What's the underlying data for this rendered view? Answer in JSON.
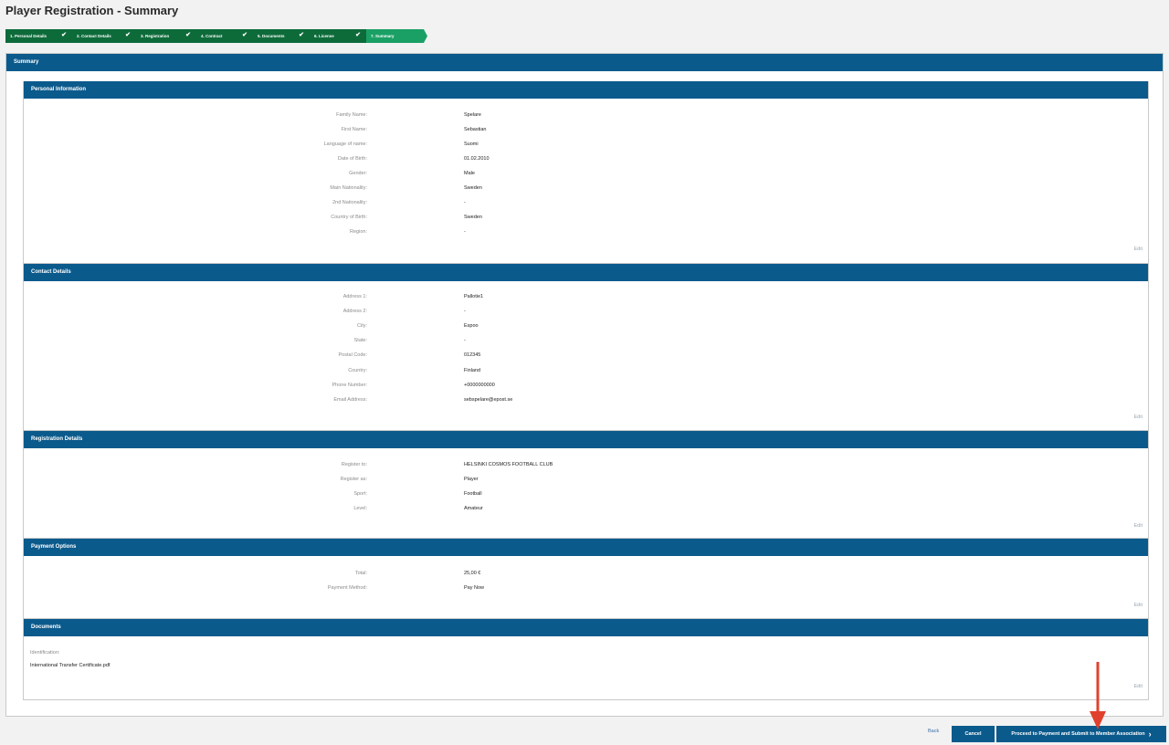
{
  "page_title": "Player Registration - Summary",
  "wizard": {
    "steps": [
      {
        "label": "1. Personal Details",
        "done": true
      },
      {
        "label": "2. Contact Details",
        "done": true
      },
      {
        "label": "3. Registration",
        "done": true
      },
      {
        "label": "4. Contract",
        "done": true
      },
      {
        "label": "5. Documents",
        "done": true
      },
      {
        "label": "6. License",
        "done": true
      },
      {
        "label": "7. Summary",
        "done": false
      }
    ],
    "check_glyph": "✔"
  },
  "summary": {
    "title": "Summary"
  },
  "edit_label": "Edit",
  "personal": {
    "title": "Personal Information",
    "rows": [
      {
        "label": "Family Name:",
        "value": "Spelare"
      },
      {
        "label": "First Name:",
        "value": "Sebastian"
      },
      {
        "label": "Language of name:",
        "value": "Suomi"
      },
      {
        "label": "Date of Birth:",
        "value": "01.02.2010"
      },
      {
        "label": "Gender:",
        "value": "Male"
      },
      {
        "label": "Main Nationality:",
        "value": "Sweden"
      },
      {
        "label": "2nd Nationality:",
        "value": "-"
      },
      {
        "label": "Country of Birth:",
        "value": "Sweden"
      },
      {
        "label": "Region:",
        "value": "-"
      }
    ]
  },
  "contact": {
    "title": "Contact Details",
    "rows": [
      {
        "label": "Address 1:",
        "value": "Pallotie1"
      },
      {
        "label": "Address 2:",
        "value": "-"
      },
      {
        "label": "City:",
        "value": "Espoo"
      },
      {
        "label": "State:",
        "value": "-"
      },
      {
        "label": "Postal Code:",
        "value": "012345"
      },
      {
        "label": "Country:",
        "value": "Finland"
      },
      {
        "label": "Phone Number:",
        "value": "+0000000000"
      },
      {
        "label": "Email Address:",
        "value": "sebspelare@epost.se"
      }
    ]
  },
  "registration": {
    "title": "Registration Details",
    "rows": [
      {
        "label": "Register to:",
        "value": "HELSINKI COSMOS FOOTBALL CLUB"
      },
      {
        "label": "Register as:",
        "value": "Player"
      },
      {
        "label": "Sport:",
        "value": "Football"
      },
      {
        "label": "Level:",
        "value": "Amateur"
      }
    ]
  },
  "payment": {
    "title": "Payment Options",
    "rows": [
      {
        "label": "Total:",
        "value": "25,00 €"
      },
      {
        "label": "Payment Method:",
        "value": "Pay Now"
      }
    ]
  },
  "documents": {
    "title": "Documents",
    "label": "Identification:",
    "file": "International Transfer Certificate.pdf"
  },
  "footer": {
    "back_label": "Back",
    "cancel_label": "Cancel",
    "proceed_label": "Proceed to Payment and Submit to Member Association",
    "proceed_icon": "›"
  },
  "colors": {
    "header_blue": "#0b5a8c",
    "step_green": "#0d6b3a",
    "step_active_green": "#1aa065",
    "annotation_red": "#e0412c"
  }
}
